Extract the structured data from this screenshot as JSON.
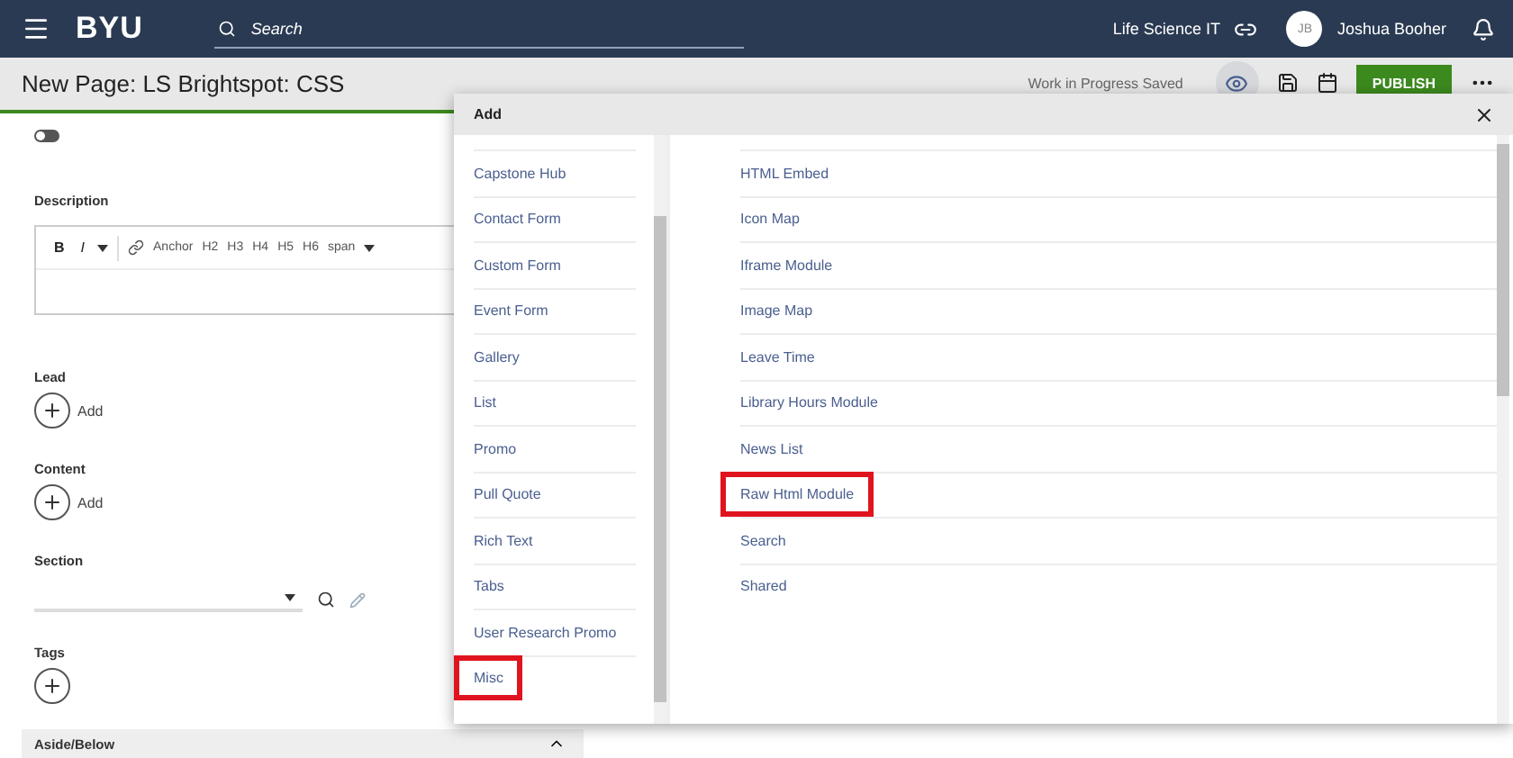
{
  "header": {
    "logo": "BYU",
    "search_placeholder": "Search",
    "org": "Life Science IT",
    "user": {
      "initials": "JB",
      "name": "Joshua Booher"
    }
  },
  "toolbar": {
    "title": "New Page: LS Brightspot: CSS",
    "status": "Work in Progress Saved",
    "publish": "PUBLISH"
  },
  "form": {
    "toggle": {
      "on": false
    },
    "description": {
      "label": "Description",
      "format_buttons": [
        {
          "label": "B",
          "kind": "bold"
        },
        {
          "label": "I",
          "kind": "italic"
        }
      ],
      "tools": [
        "Anchor",
        "H2",
        "H3",
        "H4",
        "H5",
        "H6",
        "span"
      ]
    },
    "fields": [
      {
        "label": "Lead",
        "kind": "add",
        "add_label": "Add"
      },
      {
        "label": "Content",
        "kind": "add",
        "add_label": "Add"
      },
      {
        "label": "Section",
        "kind": "select"
      },
      {
        "label": "Tags",
        "kind": "add"
      }
    ],
    "aside": {
      "label": "Aside/Below",
      "expanded": true
    }
  },
  "modal": {
    "title": "Add",
    "left_items": [
      {
        "label": "Capstone Hub",
        "highlighted": false
      },
      {
        "label": "Contact Form",
        "highlighted": false
      },
      {
        "label": "Custom Form",
        "highlighted": false
      },
      {
        "label": "Event Form",
        "highlighted": false
      },
      {
        "label": "Gallery",
        "highlighted": false
      },
      {
        "label": "List",
        "highlighted": false
      },
      {
        "label": "Promo",
        "highlighted": false
      },
      {
        "label": "Pull Quote",
        "highlighted": false
      },
      {
        "label": "Rich Text",
        "highlighted": false
      },
      {
        "label": "Tabs",
        "highlighted": false
      },
      {
        "label": "User Research Promo",
        "highlighted": false
      },
      {
        "label": "Misc",
        "highlighted": true
      }
    ],
    "right_items": [
      {
        "label": "HTML Embed",
        "highlighted": false
      },
      {
        "label": "Icon Map",
        "highlighted": false
      },
      {
        "label": "Iframe Module",
        "highlighted": false
      },
      {
        "label": "Image Map",
        "highlighted": false
      },
      {
        "label": "Leave Time",
        "highlighted": false
      },
      {
        "label": "Library Hours Module",
        "highlighted": false
      },
      {
        "label": "News List",
        "highlighted": false
      },
      {
        "label": "Raw Html Module",
        "highlighted": true
      },
      {
        "label": "Search",
        "highlighted": false
      },
      {
        "label": "Shared",
        "highlighted": false
      }
    ]
  }
}
